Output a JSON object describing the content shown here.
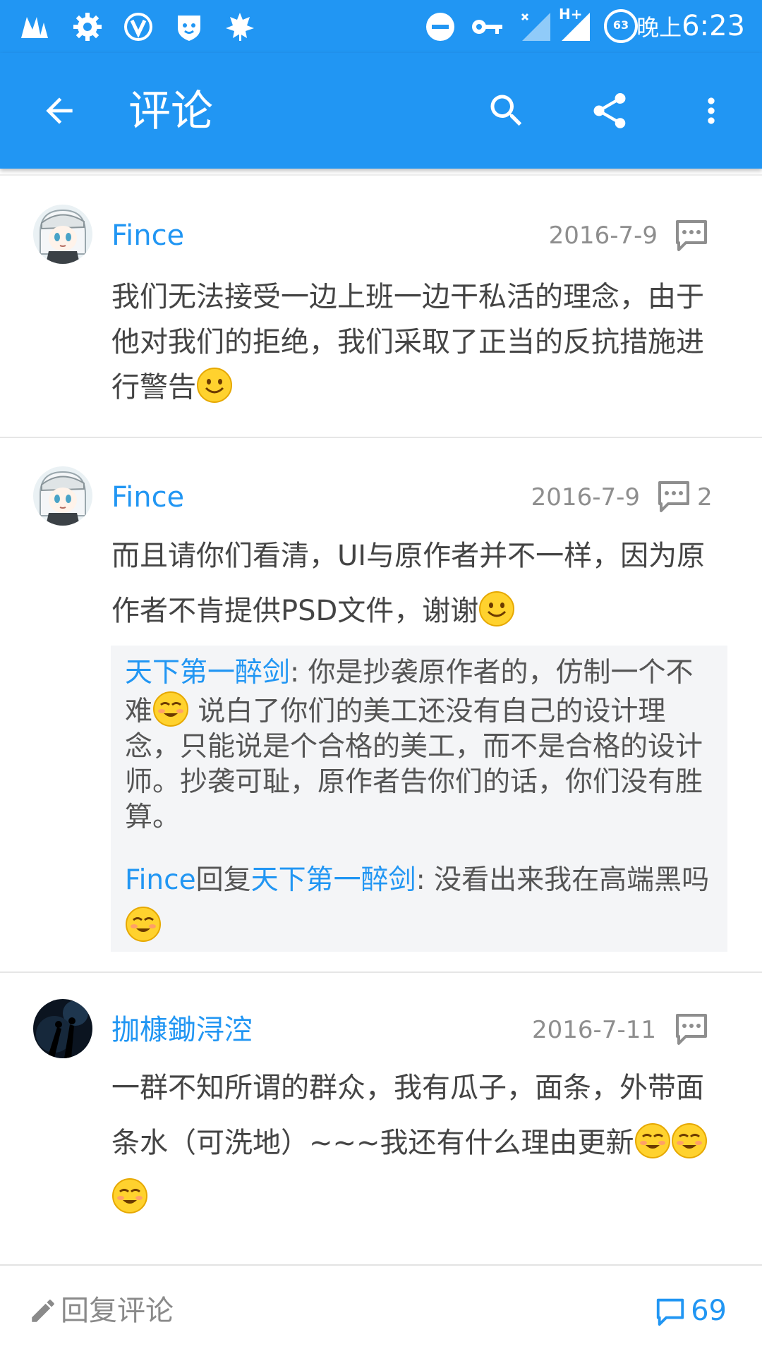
{
  "status_bar": {
    "time": "6:23",
    "ampm": "晚上",
    "battery": "63",
    "network": "H+"
  },
  "app_bar": {
    "title": "评论"
  },
  "comments": [
    {
      "author": "Fince",
      "date": "2016-7-9",
      "reply_count": "",
      "text": "我们无法接受一边上班一边干私活的理念，由于他对我们的拒绝，我们采取了正当的反抗措施进行警告"
    },
    {
      "author": "Fince",
      "date": "2016-7-9",
      "reply_count": "2",
      "text": "而且请你们看清，UI与原作者并不一样，因为原作者不肯提供PSD文件，谢谢",
      "replies": [
        {
          "author": "天下第一醉剑",
          "text1": ": 你是抄袭原作者的，仿制一个不难",
          "text2": " 说白了你们的美工还没有自己的设计理念，只能说是个合格的美工，而不是合格的设计师。抄袭可耻，原作者告你们的话，你们没有胜算。"
        },
        {
          "author": "Fince",
          "mid": "回复",
          "target": "天下第一醉剑",
          "text": ": 没看出来我在高端黑吗"
        }
      ]
    },
    {
      "author": "拁槺鋤浔涳",
      "date": "2016-7-11",
      "reply_count": "",
      "text": "一群不知所谓的群众，我有瓜子，面条，外带面条水（可洗地）~~~我还有什么理由更新"
    }
  ],
  "bottom_bar": {
    "reply_label": "回复评论",
    "comment_count": "69"
  },
  "colors": {
    "primary": "#2196f3",
    "text": "#444444",
    "muted": "#8e8e8e",
    "quote_bg": "#f4f5f7"
  }
}
